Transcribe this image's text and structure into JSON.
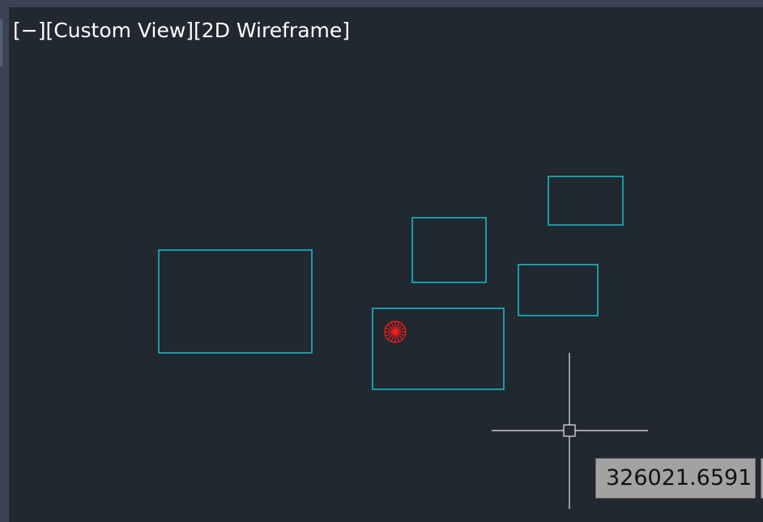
{
  "viewport": {
    "controls_label": "[−]",
    "view_label": "[Custom View]",
    "visual_style_label": "[2D Wireframe]"
  },
  "cursor": {
    "coordinate_readout": "326021.6591"
  },
  "colors": {
    "background": "#212830",
    "geometry": "#18c0cc",
    "marker": "#ff1a1a",
    "crosshair": "#e6e6e6"
  }
}
